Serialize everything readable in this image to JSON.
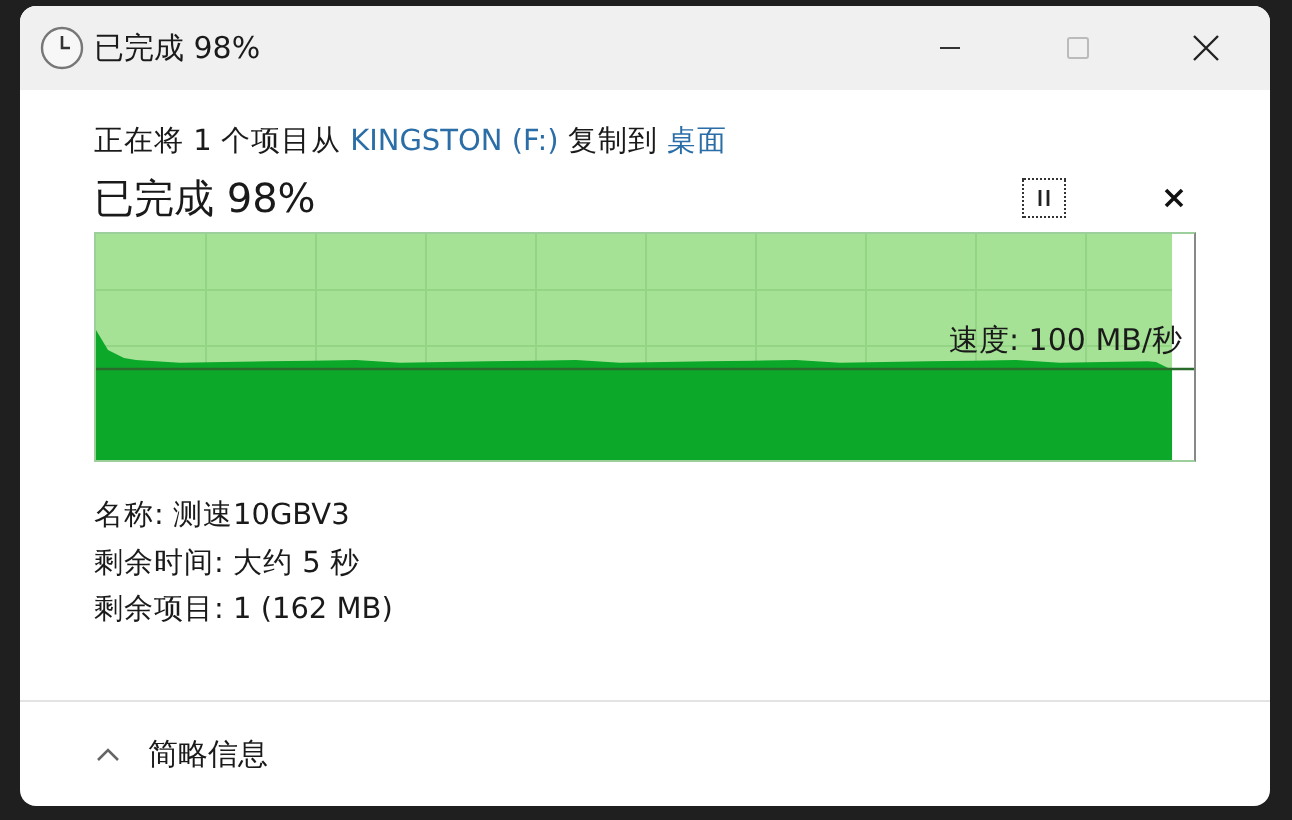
{
  "window": {
    "title": "已完成 98%"
  },
  "copy_line": {
    "prefix": "正在将 1 个项目从",
    "source": "KINGSTON (F:)",
    "middle": "复制到",
    "destination": "桌面"
  },
  "progress": {
    "heading": "已完成 98%",
    "level": 0.98,
    "speed": "速度: 100 MB/秒"
  },
  "details": [
    "名称: 测速10GBV3",
    "剩余时间: 大约 5 秒",
    "剩余项目: 1 (162 MB)"
  ],
  "footer": {
    "label": "简略信息",
    "expanded": true
  }
}
